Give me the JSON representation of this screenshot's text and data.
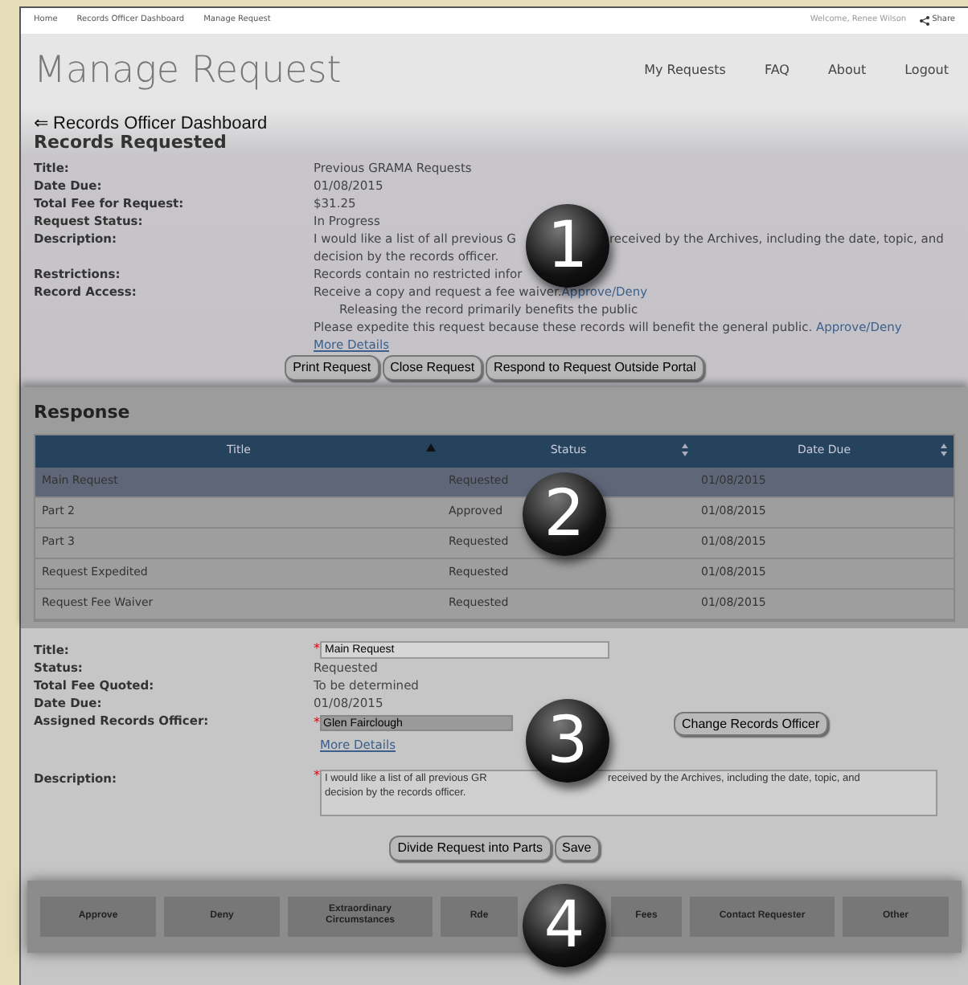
{
  "breadcrumb": [
    "Home",
    "Records Officer Dashboard",
    "Manage Request"
  ],
  "welcome": "Welcome, Renee Wilson",
  "share": "Share",
  "page_title": "Manage Request",
  "nav": [
    "My Requests",
    "FAQ",
    "About",
    "Logout"
  ],
  "back_link": "⇐ Records Officer Dashboard",
  "records_requested": {
    "heading": "Records Requested",
    "fields": [
      {
        "label": "Title:",
        "value": "Previous GRAMA Requests"
      },
      {
        "label": "Date Due:",
        "value": "01/08/2015"
      },
      {
        "label": "Total Fee for Request:",
        "value": "$31.25"
      },
      {
        "label": "Request Status:",
        "value": "In Progress"
      }
    ],
    "description": {
      "label": "Description:",
      "line1_before": "I would like a list of all previous G",
      "line1_after": "received by the Archives, including the date, topic, and",
      "line2": "decision by the records officer."
    },
    "restrictions": {
      "label": "Restrictions:",
      "value": "Records contain no restricted infor"
    },
    "record_access": {
      "label": "Record Access:",
      "line1": "Receive a copy and request a fee waiver.",
      "link1": "Approve/Deny",
      "reason": "Releasing the record primarily benefits the public",
      "line2": "Please expedite this request because these records will benefit the general public.",
      "link2": "Approve/Deny"
    },
    "more_details": "More Details",
    "buttons": [
      "Print Request",
      "Close Request",
      "Respond to Request Outside Portal"
    ]
  },
  "response": {
    "heading": "Response",
    "columns": [
      {
        "label": "Title",
        "sorted": true
      },
      {
        "label": "Status",
        "sorted": false
      },
      {
        "label": "Date Due",
        "sorted": false
      }
    ],
    "rows": [
      {
        "cells": [
          "Main Request",
          "Requested",
          "01/08/2015"
        ],
        "selected": true
      },
      {
        "cells": [
          "Part 2",
          "Approved",
          "01/08/2015"
        ],
        "selected": false
      },
      {
        "cells": [
          "Part 3",
          "Requested",
          "01/08/2015"
        ],
        "selected": false
      },
      {
        "cells": [
          "Request Expedited",
          "Requested",
          "01/08/2015"
        ],
        "selected": false
      },
      {
        "cells": [
          "Request Fee Waiver",
          "Requested",
          "01/08/2015"
        ],
        "selected": false
      }
    ]
  },
  "detail": {
    "required_mark": "*",
    "title": {
      "label": "Title:",
      "value": "Main Request"
    },
    "fields": [
      {
        "label": "Status:",
        "value": "Requested"
      },
      {
        "label": "Total Fee Quoted:",
        "value": "To be determined"
      },
      {
        "label": "Date Due:",
        "value": "01/08/2015"
      }
    ],
    "officer": {
      "label": "Assigned Records Officer:",
      "value": "Glen Fairclough",
      "button": "Change Records Officer"
    },
    "more_details": "More Details",
    "description": {
      "label": "Description:",
      "line1_before": "I would like a list of all previous GR",
      "line1_after": "received by the Archives, including the date, topic, and",
      "line2": "decision by the records officer."
    },
    "buttons": [
      "Divide Request into Parts",
      "Save"
    ]
  },
  "actions": [
    "Approve",
    "Deny",
    "Extraordinary Circumstances",
    "Rde",
    "Fees",
    "Contact Requester",
    "Other"
  ],
  "callouts": [
    "1",
    "2",
    "3",
    "4"
  ]
}
